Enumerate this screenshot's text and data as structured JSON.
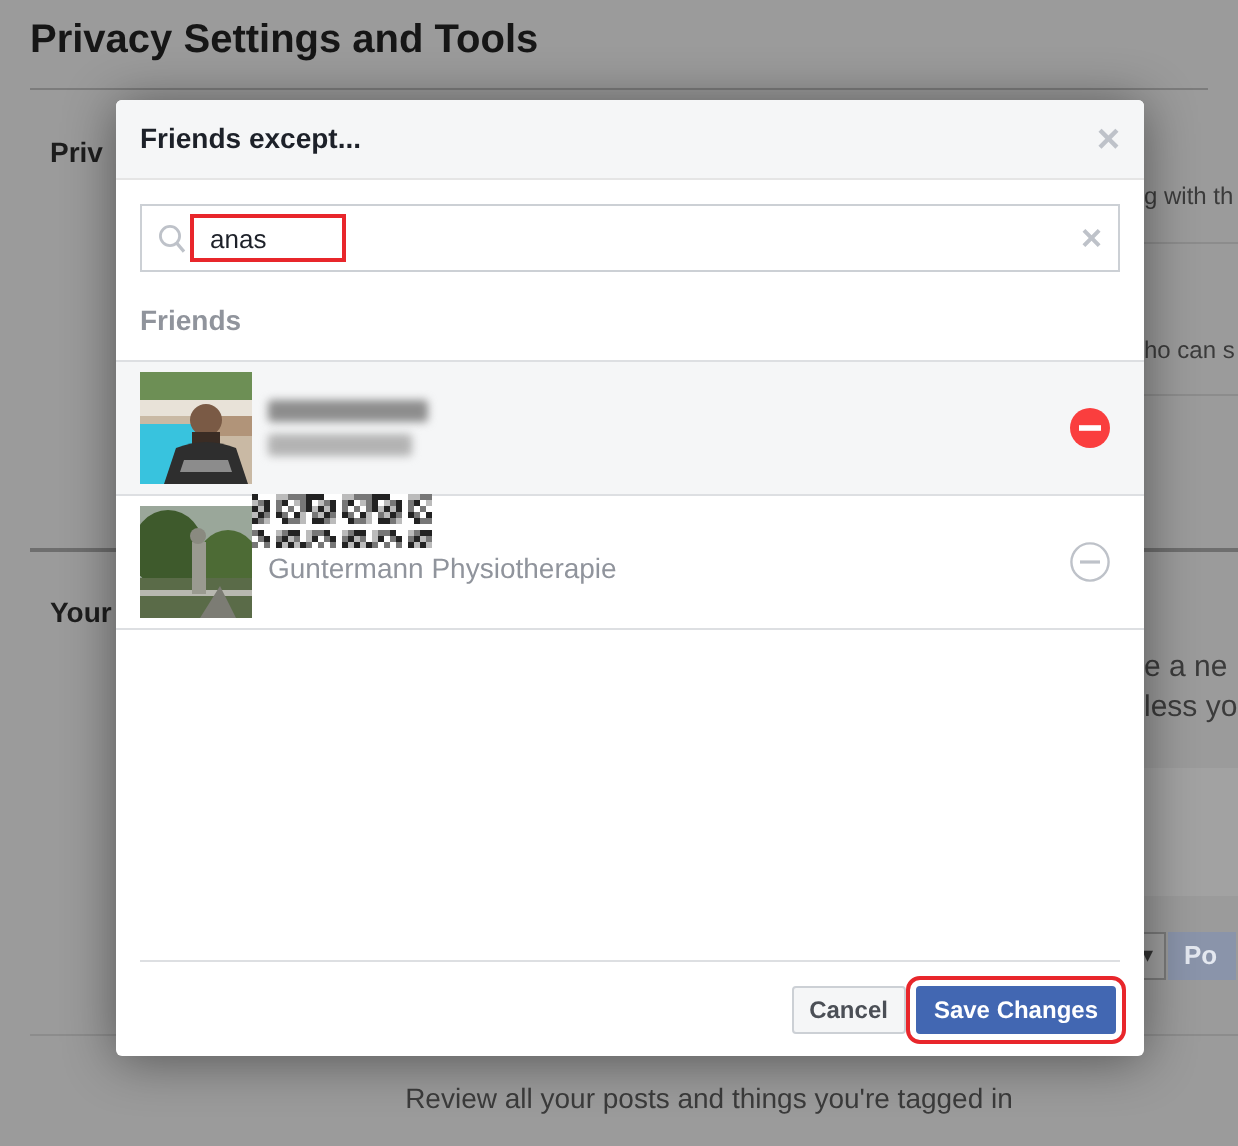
{
  "page": {
    "title": "Privacy Settings and Tools",
    "section_1_heading": "Priv",
    "section_1_text_1": "g with th",
    "section_1_text_2": "ho can s",
    "section_2_heading": "Your",
    "section_2_text_1": "e a ne",
    "section_2_text_2": "less yo",
    "select_caret": "▾",
    "post_button": "Po",
    "footer_text": "Review all your posts and things you're tagged in"
  },
  "dialog": {
    "title": "Friends except...",
    "close": "×",
    "search": {
      "value": "anas",
      "clear": "×",
      "highlighted": true
    },
    "list_heading": "Friends",
    "friends": [
      {
        "selected": true
      },
      {
        "subtitle": "Guntermann Physiotherapie",
        "selected": false
      }
    ],
    "buttons": [
      {
        "label": "Cancel",
        "kind": "secondary",
        "highlighted": false
      },
      {
        "label": "Save Changes",
        "kind": "primary",
        "highlighted": true
      }
    ]
  }
}
